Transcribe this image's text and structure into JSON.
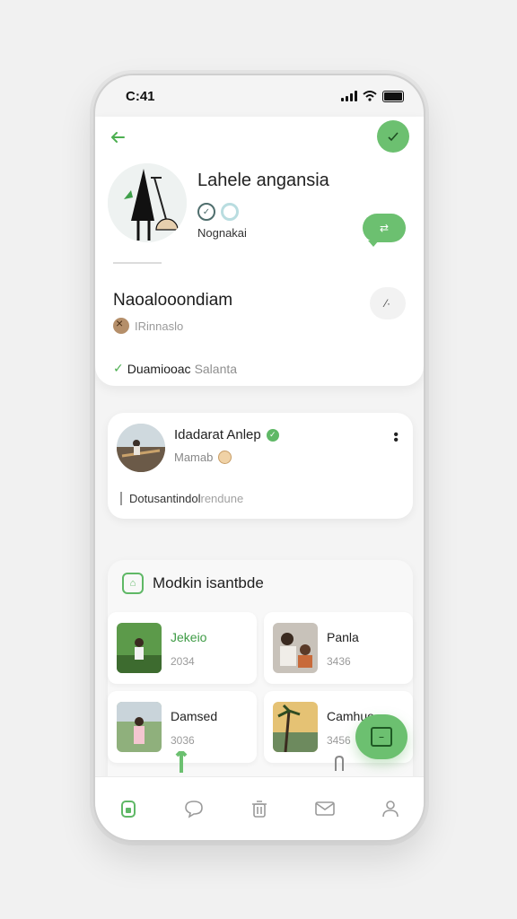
{
  "status": {
    "time": "C:41"
  },
  "profile": {
    "name": "Lahele angansia",
    "handle": "Nognakai",
    "section_title": "Naoalooondiam",
    "sub_label": "IRinnaslo",
    "tag_primary": "Duamiooac",
    "tag_secondary": "Salanta"
  },
  "post": {
    "author": "Idadarat Anlep",
    "subtitle": "Mamab",
    "text_primary": "Dotusantindol",
    "text_secondary": "rendune"
  },
  "media": {
    "title": "Modkin isantbde",
    "tiles": [
      {
        "title": "Jekeio",
        "count": "2034",
        "accent": true
      },
      {
        "title": "Panla",
        "count": "3436",
        "accent": false
      },
      {
        "title": "Damsed",
        "count": "3036",
        "accent": false
      },
      {
        "title": "Camhuo",
        "count": "3456",
        "accent": false
      }
    ]
  },
  "colors": {
    "accent": "#6cc070",
    "accent_dark": "#3e9b45"
  },
  "icons": {
    "back": "arrow-left-icon",
    "confirm": "checkmark-icon",
    "message": "chat-bubble-icon",
    "more": "kebab-icon",
    "fab": "compose-icon",
    "nav": [
      "home-icon",
      "chat-icon",
      "trash-icon",
      "mail-icon",
      "profile-icon"
    ]
  }
}
